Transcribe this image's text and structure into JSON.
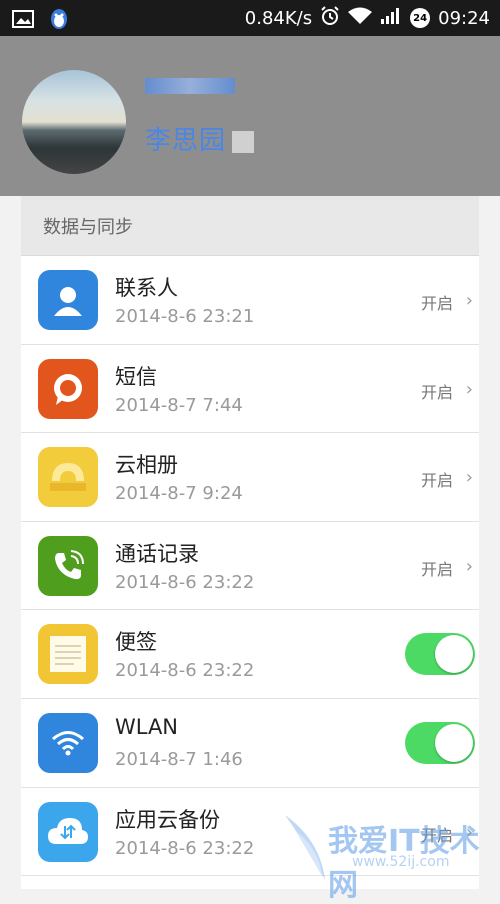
{
  "statusbar": {
    "speed": "0.84K/s",
    "badge": "24",
    "time": "09:24"
  },
  "profile": {
    "username": "•••••",
    "account": "李思园"
  },
  "section": {
    "title": "数据与同步"
  },
  "items": [
    {
      "title": "联系人",
      "time": "2014-8-6 23:21",
      "status": "开启",
      "control": "chevron",
      "icon": "contacts-icon",
      "color": "#2f86dc"
    },
    {
      "title": "短信",
      "time": "2014-8-7 7:44",
      "status": "开启",
      "control": "chevron",
      "icon": "sms-icon",
      "color": "#e2551d"
    },
    {
      "title": "云相册",
      "time": "2014-8-7 9:24",
      "status": "开启",
      "control": "chevron",
      "icon": "cloud-album-icon",
      "color": "#f2cc3a"
    },
    {
      "title": "通话记录",
      "time": "2014-8-6 23:22",
      "status": "开启",
      "control": "chevron",
      "icon": "call-log-icon",
      "color": "#4f9e1e"
    },
    {
      "title": "便签",
      "time": "2014-8-6 23:22",
      "control": "toggle",
      "on": true,
      "icon": "notes-icon",
      "color": "#f2c534"
    },
    {
      "title": "WLAN",
      "time": "2014-8-7 1:46",
      "control": "toggle",
      "on": true,
      "icon": "wlan-icon",
      "color": "#2f86dc"
    },
    {
      "title": "应用云备份",
      "time": "2014-8-6 23:22",
      "status": "开启",
      "control": "chevron",
      "icon": "app-backup-icon",
      "color": "#3ba6ec"
    }
  ],
  "watermark": {
    "main": "我爱IT技术网",
    "sub": "www.52ij.com"
  }
}
